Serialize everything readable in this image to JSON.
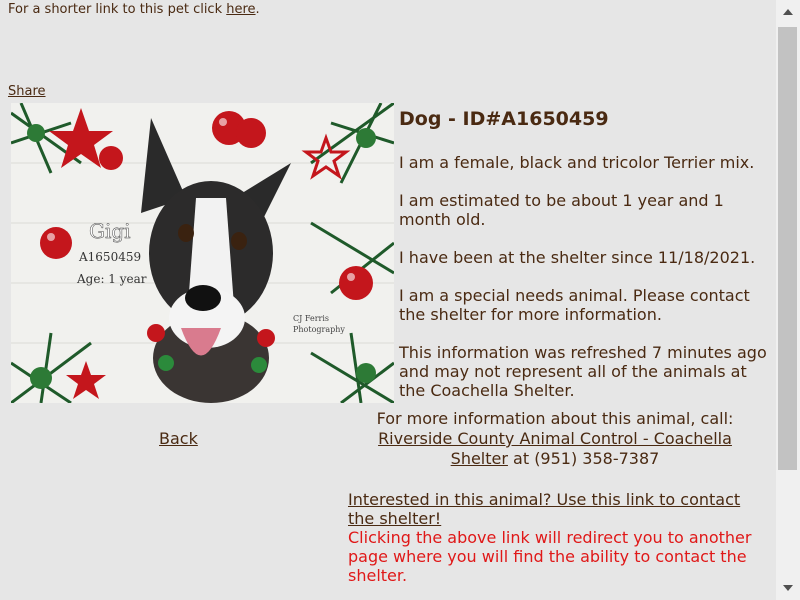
{
  "shortlink": {
    "prefix": "For a shorter link to this pet click ",
    "link": "here",
    "suffix": "."
  },
  "share": "Share",
  "photo": {
    "name": "Gigi",
    "id_line": "A1650459",
    "age_line": "Age: 1 year",
    "credit_1": "CJ Ferris",
    "credit_2": "Photography"
  },
  "animal": {
    "title": "Dog - ID#A1650459",
    "description": "I am a female, black and tricolor Terrier mix.",
    "age": "I am estimated to be about 1 year and 1 month old.",
    "since": "I have been at the shelter since 11/18/2021.",
    "special": "I am a special needs animal. Please contact the shelter for more information.",
    "refreshed": "This information was refreshed 7 minutes ago and may not represent all of the animals at the Coachella Shelter."
  },
  "back": "Back",
  "contact": {
    "intro": "For more information about this animal, call:",
    "shelter_link": "Riverside County Animal Control - Coachella Shelter",
    "phone": " at (951) 358-7387"
  },
  "interest": {
    "link": "Interested in this animal? Use this link to contact the shelter!",
    "note": "Clicking the above link will redirect you to another page where you will find the ability to contact the shelter."
  },
  "colors": {
    "text": "#4a2a12",
    "background": "#e6e6e6",
    "warning": "#e01818"
  }
}
